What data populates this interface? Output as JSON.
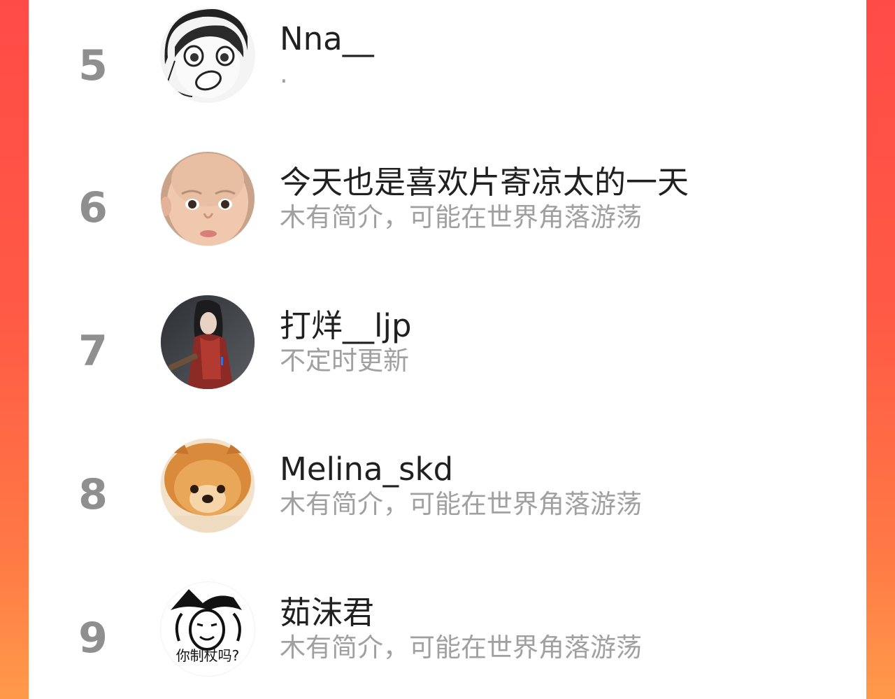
{
  "accent_left": "#ff4b47",
  "accent_right": "#ff8a45",
  "list": {
    "items": [
      {
        "rank": "5",
        "name": "Nna__",
        "bio": ".",
        "avatar_icon": "manga-girl-avatar-icon"
      },
      {
        "rank": "6",
        "name": "今天也是喜欢片寄凉太的一天",
        "bio": "木有简介，可能在世界角落游荡",
        "avatar_icon": "baby-face-avatar-icon"
      },
      {
        "rank": "7",
        "name": "打烊__ljp",
        "bio": "不定时更新",
        "avatar_icon": "red-scarf-figure-avatar-icon"
      },
      {
        "rank": "8",
        "name": "Melina_skd",
        "bio": "木有简介，可能在世界角落游荡",
        "avatar_icon": "pomeranian-dog-avatar-icon"
      },
      {
        "rank": "9",
        "name": "茹沫君",
        "bio": "木有简介，可能在世界角落游荡",
        "avatar_icon": "meme-wizard-avatar-icon",
        "avatar_caption": "你制杖吗?"
      }
    ]
  }
}
